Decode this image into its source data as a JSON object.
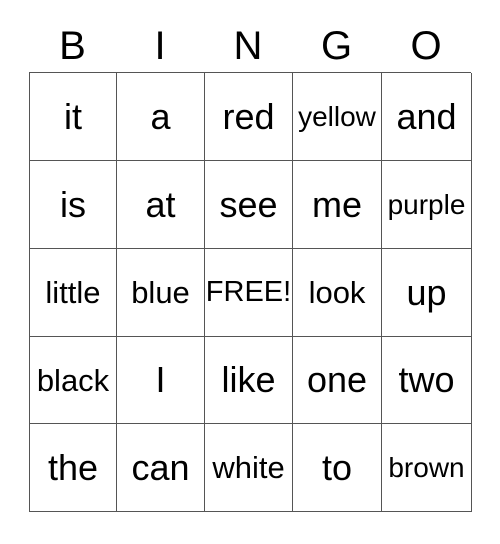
{
  "card": {
    "headers": [
      "B",
      "I",
      "N",
      "G",
      "O"
    ],
    "rows": [
      [
        {
          "text": "it",
          "size": "lg"
        },
        {
          "text": "a",
          "size": "lg"
        },
        {
          "text": "red",
          "size": "lg"
        },
        {
          "text": "yellow",
          "size": "sm"
        },
        {
          "text": "and",
          "size": "lg"
        }
      ],
      [
        {
          "text": "is",
          "size": "lg"
        },
        {
          "text": "at",
          "size": "lg"
        },
        {
          "text": "see",
          "size": "lg"
        },
        {
          "text": "me",
          "size": "lg"
        },
        {
          "text": "purple",
          "size": "sm"
        }
      ],
      [
        {
          "text": "little",
          "size": "md"
        },
        {
          "text": "blue",
          "size": "md"
        },
        {
          "text": "FREE!",
          "size": "free"
        },
        {
          "text": "look",
          "size": "md"
        },
        {
          "text": "up",
          "size": "lg"
        }
      ],
      [
        {
          "text": "black",
          "size": "md"
        },
        {
          "text": "I",
          "size": "lg"
        },
        {
          "text": "like",
          "size": "lg"
        },
        {
          "text": "one",
          "size": "lg"
        },
        {
          "text": "two",
          "size": "lg"
        }
      ],
      [
        {
          "text": "the",
          "size": "lg"
        },
        {
          "text": "can",
          "size": "lg"
        },
        {
          "text": "white",
          "size": "md"
        },
        {
          "text": "to",
          "size": "lg"
        },
        {
          "text": "brown",
          "size": "sm"
        }
      ]
    ],
    "free_space_label": "FREE!",
    "colors": {
      "text": "#000000",
      "grid_line": "#555555",
      "background": "#ffffff"
    }
  }
}
